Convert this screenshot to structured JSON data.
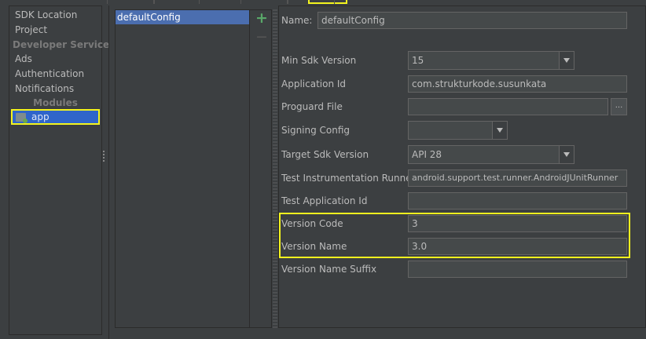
{
  "sidebar": {
    "items": [
      {
        "label": "SDK Location"
      },
      {
        "label": "Project"
      }
    ],
    "developer_services_header": "Developer Services",
    "developer_services": [
      {
        "label": "Ads"
      },
      {
        "label": "Authentication"
      },
      {
        "label": "Notifications"
      }
    ],
    "modules_header": "Modules",
    "modules": [
      {
        "label": "app",
        "icon": "module-folder-icon",
        "selected": true
      }
    ]
  },
  "config_list": {
    "items": [
      {
        "label": "defaultConfig",
        "selected": true
      }
    ],
    "add_icon": "plus-icon",
    "remove_icon": "minus-icon"
  },
  "form": {
    "name": {
      "label": "Name:",
      "value": "defaultConfig"
    },
    "min_sdk": {
      "label": "Min Sdk Version",
      "value": "15"
    },
    "application_id": {
      "label": "Application Id",
      "value": "com.strukturkode.susunkata"
    },
    "proguard_file": {
      "label": "Proguard File",
      "value": "",
      "browse_label": "..."
    },
    "signing_config": {
      "label": "Signing Config",
      "value": ""
    },
    "target_sdk": {
      "label": "Target Sdk Version",
      "value": "API 28"
    },
    "test_runner": {
      "label": "Test Instrumentation Runner",
      "value": "android.support.test.runner.AndroidJUnitRunner"
    },
    "test_app_id": {
      "label": "Test Application Id",
      "value": ""
    },
    "version_code": {
      "label": "Version Code",
      "value": "3"
    },
    "version_name": {
      "label": "Version Name",
      "value": "3.0"
    },
    "version_name_suffix": {
      "label": "Version Name Suffix",
      "value": ""
    }
  },
  "colors": {
    "background": "#3c3f41",
    "selection": "#4b6eaf",
    "highlight": "#f4f41e",
    "add_green": "#59a869"
  }
}
